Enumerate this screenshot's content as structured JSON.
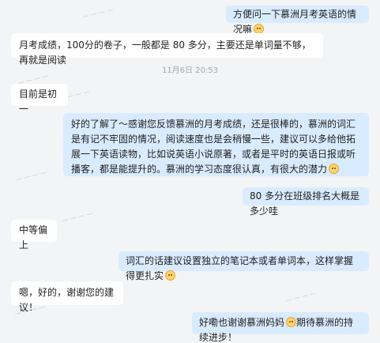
{
  "chat": {
    "timestamp": "11月6日 20:53",
    "emoji_icon": "smiling-face-icon",
    "messages": [
      {
        "side": "right",
        "text": "方便问一下慕洲月考英语的情况嘛"
      },
      {
        "side": "left",
        "text": "月考成绩，100分的卷子，一般都是 80 多分，主要还是单词量不够，再就是阅读"
      },
      {
        "side": "left",
        "text": "目前是初一"
      },
      {
        "side": "right",
        "text": "好的了解了～感谢您反馈慕洲的月考成绩，还是很棒的，慕洲的词汇是有记不牢固的情况，阅读速度也是会稍慢一些，建议可以多给他拓展一下英语读物，比如说英语小说原著，或者是平时的英语日报或听播客，都是能提升的。慕洲的学习态度很认真，有很大的潜力"
      },
      {
        "side": "right",
        "text": "80 多分在班级排名大概是多少哇"
      },
      {
        "side": "left",
        "text": "中等偏上"
      },
      {
        "side": "right",
        "text": "词汇的话建议设置独立的笔记本或者单词本，这样掌握得更扎实"
      },
      {
        "side": "left",
        "text": "嗯，好的，谢谢您的建议！"
      },
      {
        "side": "right",
        "text": "好嘞也谢谢慕洲妈妈",
        "text_after": "期待慕洲的持续进步！"
      }
    ]
  }
}
